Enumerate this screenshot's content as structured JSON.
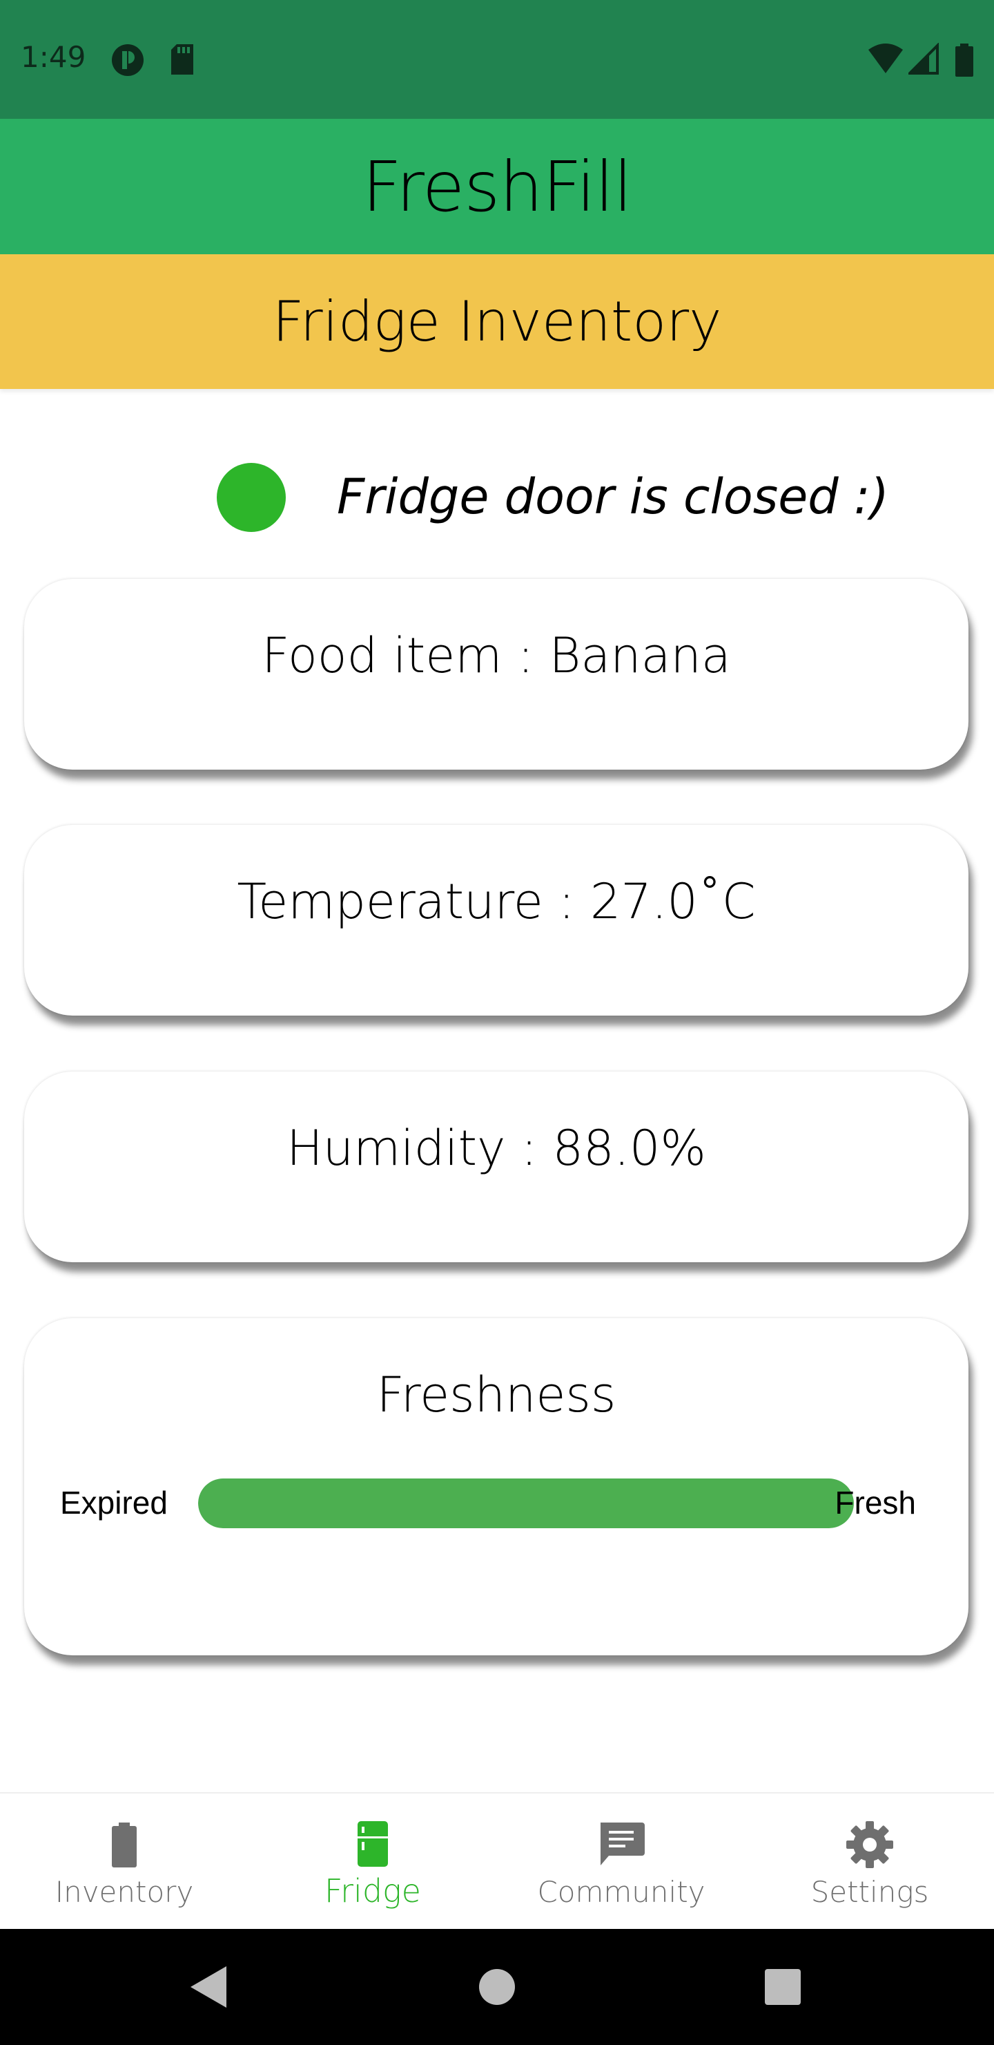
{
  "status_bar": {
    "time": "1:49",
    "icons": [
      "app-notification-icon",
      "sd-card-icon",
      "wifi-icon",
      "signal-icon",
      "battery-icon"
    ]
  },
  "app_bar": {
    "title": "FreshFill"
  },
  "section": {
    "title": "Fridge Inventory"
  },
  "door": {
    "status_text": "Fridge door is closed :)",
    "indicator_color": "#2db52a"
  },
  "cards": {
    "food_item": "Food item : Banana",
    "temperature": "Temperature : 27.0˚C",
    "humidity": "Humidity : 88.0%",
    "freshness": {
      "title": "Freshness",
      "left_label": "Expired",
      "right_label": "Fresh",
      "level": 1.0
    }
  },
  "bottom_nav": {
    "items": [
      {
        "label": "Inventory",
        "icon": "battery-icon",
        "active": false
      },
      {
        "label": "Fridge",
        "icon": "fridge-icon",
        "active": true
      },
      {
        "label": "Community",
        "icon": "chat-icon",
        "active": false
      },
      {
        "label": "Settings",
        "icon": "gear-icon",
        "active": false
      }
    ]
  },
  "colors": {
    "status_bar": "#218350",
    "app_bar": "#2ab063",
    "section_header": "#f2c54d",
    "accent_green": "#2db52a",
    "progress_fill": "#4caf50",
    "inactive_nav": "#6f6f6f"
  }
}
